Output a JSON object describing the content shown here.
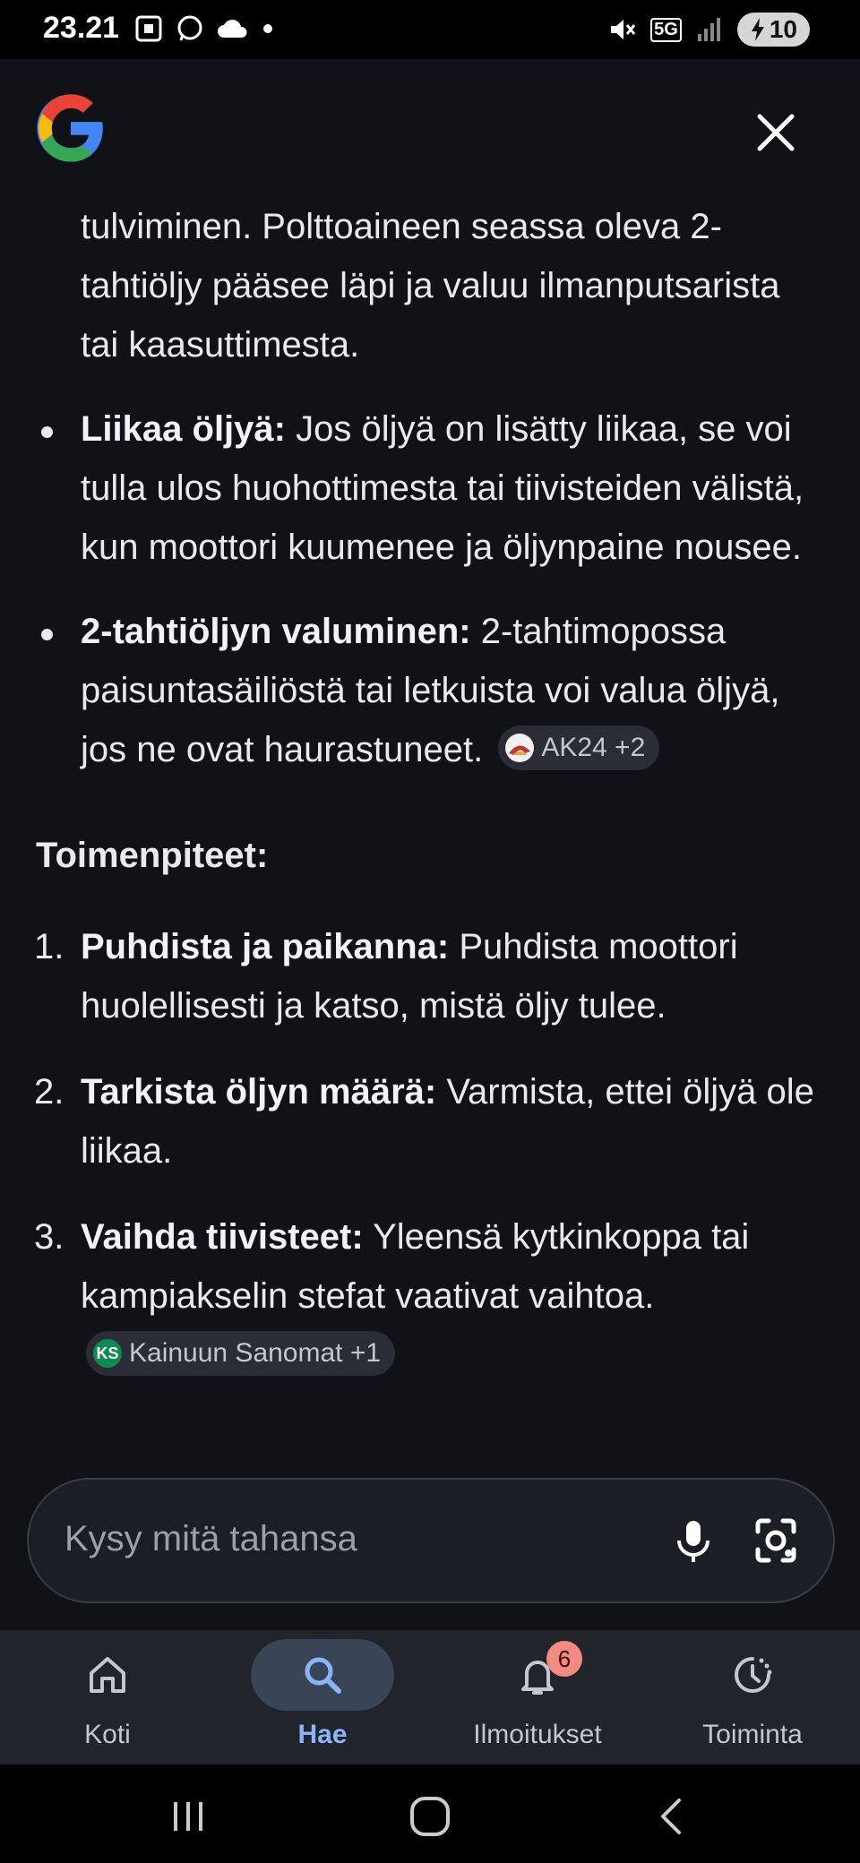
{
  "status_bar": {
    "time": "23.21",
    "battery_level": "10",
    "network": "5G"
  },
  "header": {
    "logo": "google-g-logo",
    "close_icon": "close-icon"
  },
  "content": {
    "intro_text": "tulviminen. Polttoaineen seassa oleva 2-tahtiöljy pääsee läpi ja valuu ilmanputsarista tai kaasuttimesta.",
    "bullets": [
      {
        "bold": "Liikaa öljyä:",
        "text": " Jos öljyä on lisätty liikaa, se voi tulla ulos huohottimesta tai tiivisteiden välistä, kun moottori kuumenee ja öljynpaine nousee."
      },
      {
        "bold": "2-tahtiöljyn valuminen:",
        "text": " 2-tahtimopossa paisuntasäiliöstä tai letkuista voi valua öljyä, jos ne ovat haurastuneet.",
        "source_chip": "AK24 +2"
      }
    ],
    "section_heading": "Toimenpiteet:",
    "steps": [
      {
        "num": "1.",
        "bold": "Puhdista ja paikanna:",
        "text": " Puhdista moottori huolellisesti ja katso, mistä öljy tulee."
      },
      {
        "num": "2.",
        "bold": "Tarkista öljyn määrä:",
        "text": " Varmista, ettei öljyä ole liikaa."
      },
      {
        "num": "3.",
        "bold": "Vaihda tiivisteet:",
        "text": " Yleensä kytkinkoppa tai kampiakselin stefat vaativat vaihtoa.",
        "source_chip": "Kainuun Sanomat +1",
        "source_chip_icon_text": "KS"
      }
    ]
  },
  "search": {
    "placeholder": "Kysy mitä tahansa"
  },
  "bottom_nav": {
    "items": [
      {
        "label": "Koti",
        "icon": "home-icon"
      },
      {
        "label": "Hae",
        "icon": "search-icon"
      },
      {
        "label": "Ilmoitukset",
        "icon": "bell-icon",
        "badge": "6"
      },
      {
        "label": "Toiminta",
        "icon": "activity-icon"
      }
    ],
    "active_color": "#8ab4f8"
  }
}
